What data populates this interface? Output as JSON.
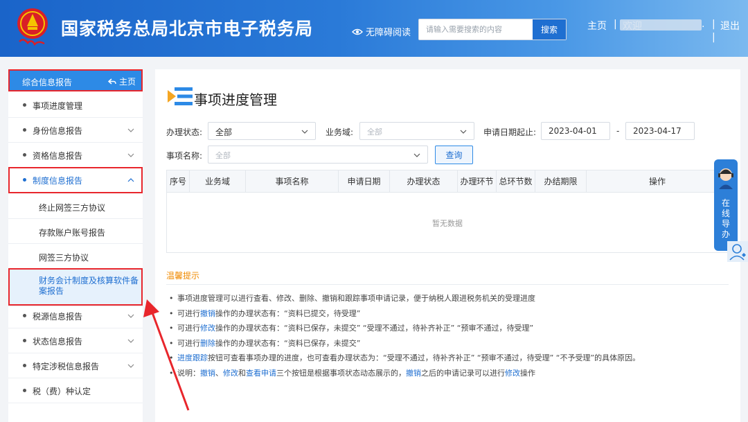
{
  "header": {
    "site_title": "国家税务总局北京市电子税务局",
    "accessibility_label": "无障碍阅读",
    "search_placeholder": "请输入需要搜索的内容",
    "search_button": "搜索",
    "home_link": "主页",
    "sep": "|",
    "welcome": "欢迎",
    "logout": "退出",
    "brand_color": "#1a64c9"
  },
  "sidebar": {
    "head_label": "综合信息报告",
    "home_label": "主页",
    "items": [
      {
        "label": "事项进度管理"
      },
      {
        "label": "身份信息报告"
      },
      {
        "label": "资格信息报告"
      },
      {
        "label": "制度信息报告"
      }
    ],
    "sub_items": [
      {
        "label": "终止网签三方协议"
      },
      {
        "label": "存款账户账号报告"
      },
      {
        "label": "网签三方协议"
      },
      {
        "label": "财务会计制度及核算软件备案报告"
      }
    ],
    "items_after": [
      {
        "label": "税源信息报告"
      },
      {
        "label": "状态信息报告"
      },
      {
        "label": "特定涉税信息报告"
      },
      {
        "label": "税（费）种认定"
      }
    ]
  },
  "main": {
    "title": "事项进度管理",
    "filters": {
      "status_label": "办理状态:",
      "status_value": "全部",
      "domain_label": "业务域:",
      "domain_placeholder": "全部",
      "date_label": "申请日期起止:",
      "date_start": "2023-04-01",
      "date_dash": "-",
      "date_end": "2023-04-17",
      "name_label": "事项名称:",
      "name_placeholder": "全部",
      "query_button": "查询"
    },
    "table": {
      "columns": [
        "序号",
        "业务域",
        "事项名称",
        "申请日期",
        "办理状态",
        "办理环节",
        "总环节数",
        "办结期限",
        "操作"
      ],
      "empty_text": "暂无数据"
    },
    "tips": {
      "title": "温馨提示",
      "lines": [
        [
          {
            "t": "事项进度管理可以进行查看、修改、删除、撤销和跟踪事项申请记录，便于纳税人跟进税务机关的受理进度"
          }
        ],
        [
          {
            "t": "可进行"
          },
          {
            "t": "撤销",
            "b": true
          },
          {
            "t": "操作的办理状态有：“资料已提交，待受理”"
          }
        ],
        [
          {
            "t": "可进行"
          },
          {
            "t": "修改",
            "b": true
          },
          {
            "t": "操作的办理状态有：“资料已保存，未提交”  “受理不通过，待补齐补正”  “预审不通过，待受理”"
          }
        ],
        [
          {
            "t": "可进行"
          },
          {
            "t": "删除",
            "b": true
          },
          {
            "t": "操作的办理状态有：“资料已保存，未提交”"
          }
        ],
        [
          {
            "t": "进度跟踪",
            "b": true
          },
          {
            "t": "按钮可查看事项办理的进度，也可查看办理状态为：“受理不通过，待补齐补正”  “预审不通过，待受理”  “不予受理”的具体原因。"
          }
        ],
        [
          {
            "t": "说明："
          },
          {
            "t": "撤销",
            "b": true
          },
          {
            "t": "、"
          },
          {
            "t": "修改",
            "b": true
          },
          {
            "t": "和"
          },
          {
            "t": "查看申请",
            "b": true
          },
          {
            "t": "三个按钮是根据事项状态动态展示的，"
          },
          {
            "t": "撤销",
            "b": true
          },
          {
            "t": "之后的申请记录可以进行"
          },
          {
            "t": "修改",
            "b": true
          },
          {
            "t": "操作"
          }
        ]
      ]
    }
  },
  "float": {
    "guide_text": "在线导办"
  }
}
